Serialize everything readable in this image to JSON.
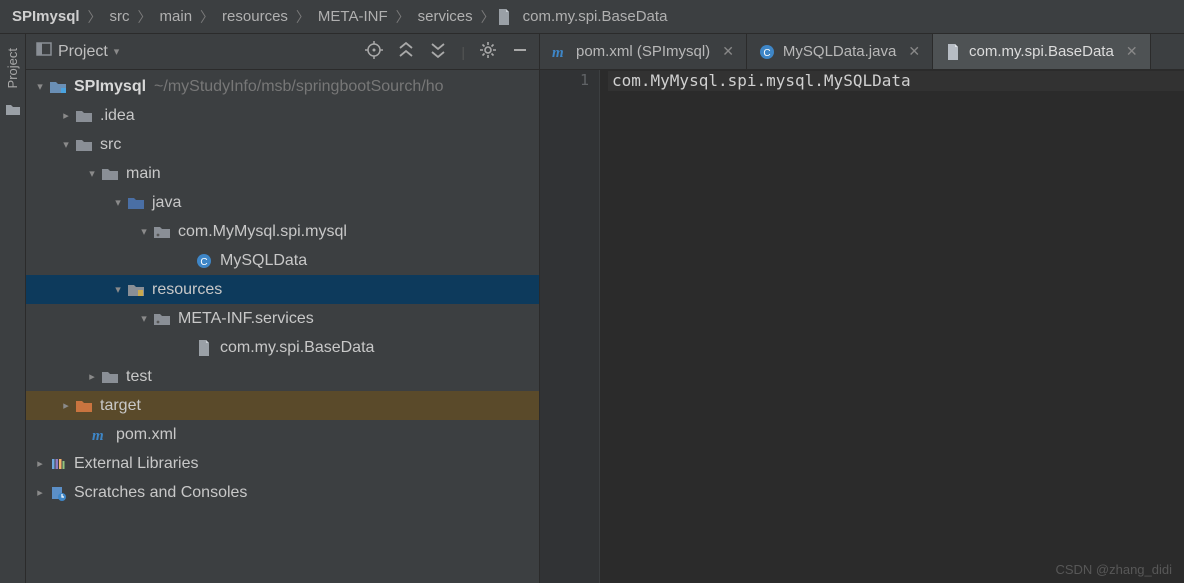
{
  "breadcrumb": {
    "items": [
      "SPImysql",
      "src",
      "main",
      "resources",
      "META-INF",
      "services",
      "com.my.spi.BaseData"
    ]
  },
  "sidebar": {
    "vertical_tab": "Project",
    "header_label": "Project"
  },
  "tree": {
    "root": {
      "label": "SPImysql",
      "hint": "~/myStudyInfo/msb/springbootSourch/ho"
    },
    "idea": ".idea",
    "src": "src",
    "main": "main",
    "java": "java",
    "pkg": "com.MyMysql.spi.mysql",
    "mysqlclass": "MySQLData",
    "resources": "resources",
    "metainf": "META-INF.services",
    "basedata": "com.my.spi.BaseData",
    "test": "test",
    "target": "target",
    "pom": "pom.xml",
    "extlib": "External Libraries",
    "scratch": "Scratches and Consoles"
  },
  "tabs": [
    {
      "label": "pom.xml (SPImysql)",
      "type": "maven",
      "active": false
    },
    {
      "label": "MySQLData.java",
      "type": "class",
      "active": false
    },
    {
      "label": "com.my.spi.BaseData",
      "type": "file",
      "active": true
    }
  ],
  "editor": {
    "lines": [
      {
        "num": "1",
        "text": "com.MyMysql.spi.mysql.MySQLData"
      }
    ]
  },
  "watermark": "CSDN @zhang_didi"
}
